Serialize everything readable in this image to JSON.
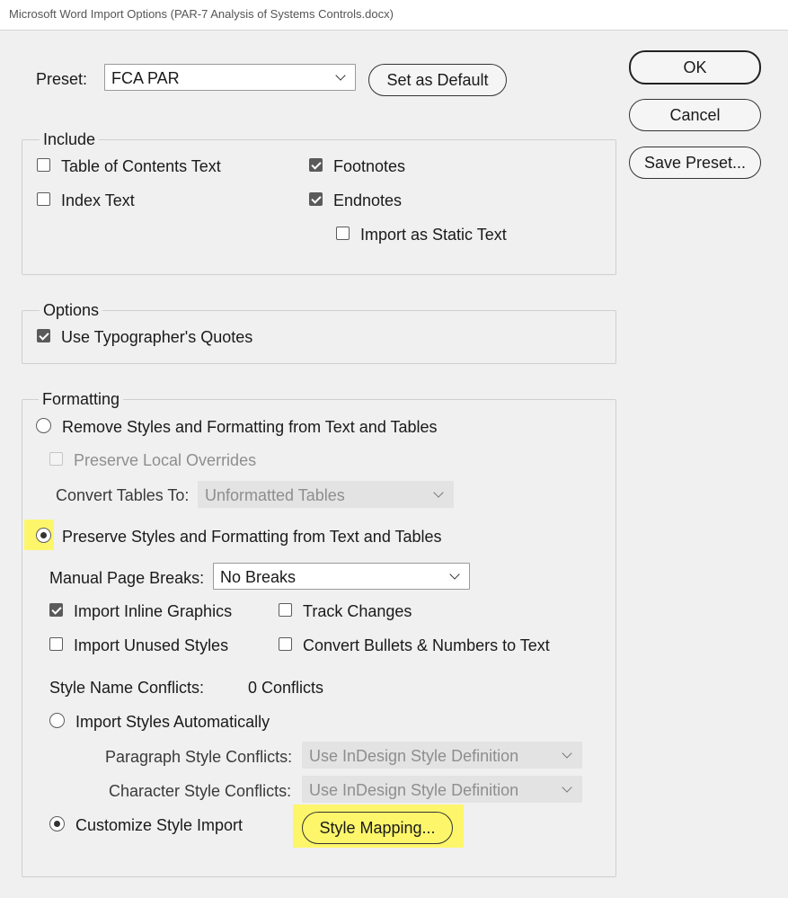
{
  "window": {
    "title": "Microsoft Word Import Options (PAR-7 Analysis of Systems Controls.docx)"
  },
  "preset": {
    "label": "Preset:",
    "value": "FCA PAR",
    "set_default": "Set as Default"
  },
  "actions": {
    "ok": "OK",
    "cancel": "Cancel",
    "save_preset": "Save Preset..."
  },
  "include": {
    "title": "Include",
    "toc_text": "Table of Contents Text",
    "toc_checked": false,
    "index_text": "Index Text",
    "index_checked": false,
    "footnotes": "Footnotes",
    "footnotes_checked": true,
    "endnotes": "Endnotes",
    "endnotes_checked": true,
    "static_text": "Import as Static Text",
    "static_checked": false
  },
  "options": {
    "title": "Options",
    "quotes": "Use Typographer's Quotes",
    "quotes_checked": true
  },
  "formatting": {
    "title": "Formatting",
    "remove": "Remove Styles and Formatting from Text and Tables",
    "preserve_overrides": "Preserve Local Overrides",
    "convert_tables_label": "Convert Tables To:",
    "convert_tables_value": "Unformatted Tables",
    "preserve": "Preserve Styles and Formatting from Text and Tables",
    "page_breaks_label": "Manual Page Breaks:",
    "page_breaks_value": "No Breaks",
    "inline_graphics": "Import Inline Graphics",
    "inline_checked": true,
    "track_changes": "Track Changes",
    "track_checked": false,
    "unused_styles": "Import Unused Styles",
    "unused_checked": false,
    "convert_bullets": "Convert Bullets & Numbers to Text",
    "bullets_checked": false,
    "conflicts_label": "Style Name Conflicts:",
    "conflicts_value": "0 Conflicts",
    "auto_import": "Import Styles Automatically",
    "para_conflicts_label": "Paragraph Style Conflicts:",
    "para_conflicts_value": "Use InDesign Style Definition",
    "char_conflicts_label": "Character Style Conflicts:",
    "char_conflicts_value": "Use InDesign Style Definition",
    "customize": "Customize Style Import",
    "style_mapping": "Style Mapping..."
  },
  "colors": {
    "highlight": "#fdf66b"
  }
}
